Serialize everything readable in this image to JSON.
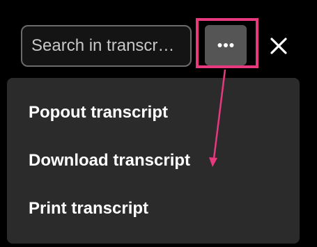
{
  "search": {
    "placeholder": "Search in transcr…"
  },
  "toolbar": {
    "more_icon": "more-horizontal-icon",
    "close_icon": "close-icon"
  },
  "menu": {
    "items": [
      {
        "label": "Popout transcript"
      },
      {
        "label": "Download transcript"
      },
      {
        "label": "Print transcript"
      }
    ]
  },
  "colors": {
    "background": "#000000",
    "menu_background": "#2b2b2b",
    "button_background": "#555555",
    "highlight": "#e8397f",
    "text": "#ffffff"
  }
}
